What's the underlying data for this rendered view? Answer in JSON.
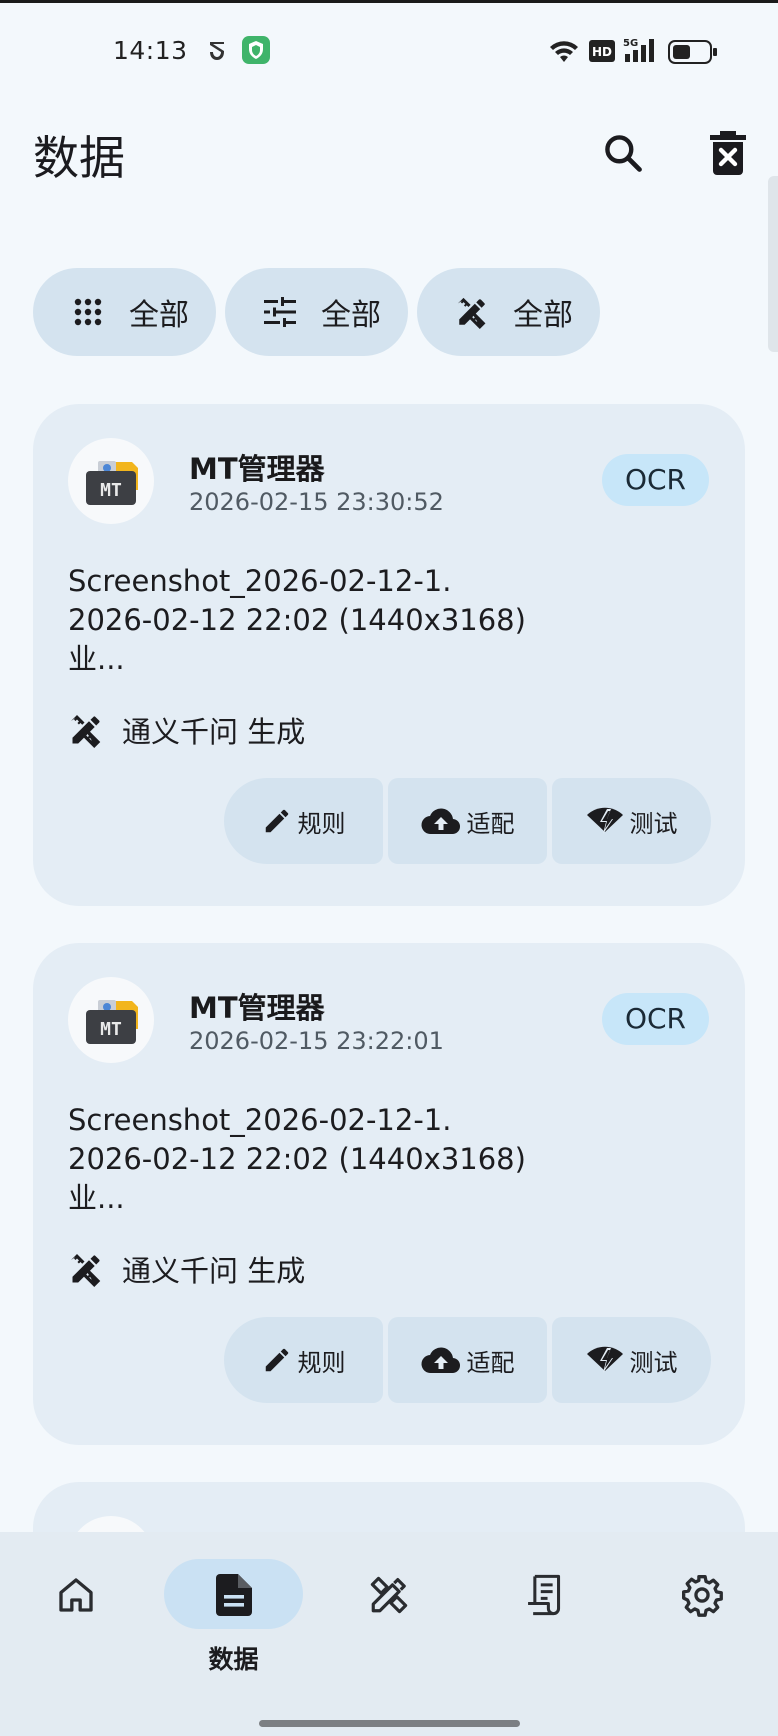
{
  "status_bar": {
    "time": "14:13",
    "icons": [
      "vpn-icon",
      "shield-app-icon",
      "wifi-icon",
      "hd-icon",
      "signal-5g-icon",
      "battery-icon"
    ],
    "hd": "HD",
    "net": "5G"
  },
  "header": {
    "title": "数据",
    "search_icon": "search-icon",
    "delete_icon": "delete-icon"
  },
  "filters": [
    {
      "icon": "apps-grid-icon",
      "label": "全部"
    },
    {
      "icon": "tune-icon",
      "label": "全部"
    },
    {
      "icon": "design-tools-icon",
      "label": "全部"
    }
  ],
  "records": [
    {
      "app_name": "MT管理器",
      "timestamp": "2026-02-15 23:30:52",
      "tag": "OCR",
      "text_lines": [
        "Screenshot_2026-02-12-1.",
        "2026-02-12 22:02 (1440x3168)",
        "业..."
      ],
      "model": "通义千问 生成",
      "avatar_letters": "MT",
      "actions": [
        {
          "icon": "edit-icon",
          "label": "规则"
        },
        {
          "icon": "cloud-upload-icon",
          "label": "适配"
        },
        {
          "icon": "network-test-icon",
          "label": "测试"
        }
      ]
    },
    {
      "app_name": "MT管理器",
      "timestamp": "2026-02-15 23:22:01",
      "tag": "OCR",
      "text_lines": [
        "Screenshot_2026-02-12-1.",
        "2026-02-12 22:02 (1440x3168)",
        "业..."
      ],
      "model": "通义千问 生成",
      "avatar_letters": "MT",
      "actions": [
        {
          "icon": "edit-icon",
          "label": "规则"
        },
        {
          "icon": "cloud-upload-icon",
          "label": "适配"
        },
        {
          "icon": "network-test-icon",
          "label": "测试"
        }
      ]
    }
  ],
  "bottom_nav": {
    "items": [
      {
        "icon": "home-icon",
        "label": ""
      },
      {
        "icon": "document-icon",
        "label": "数据",
        "active": true
      },
      {
        "icon": "design-tools-icon",
        "label": ""
      },
      {
        "icon": "receipt-icon",
        "label": ""
      },
      {
        "icon": "settings-icon",
        "label": ""
      }
    ]
  },
  "colors": {
    "background": "#f3f8fc",
    "card": "#e4edf5",
    "chip": "#d4e3ef",
    "tag": "#c7e6f9",
    "nav": "#e3ebf2",
    "nav_active": "#cae1f3"
  }
}
